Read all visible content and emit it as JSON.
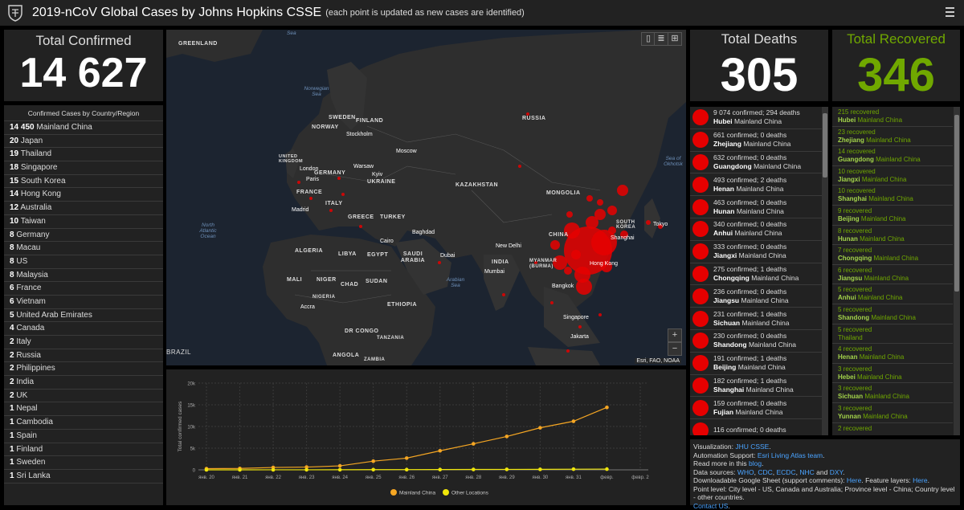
{
  "header": {
    "title": "2019-nCoV Global Cases by Johns Hopkins CSSE",
    "subtitle": "(each point is updated as new cases are identified)"
  },
  "total_confirmed": {
    "label": "Total Confirmed",
    "value": "14 627"
  },
  "country_list": {
    "heading": "Confirmed Cases by Country/Region",
    "items": [
      {
        "count": "14 450",
        "name": "Mainland China"
      },
      {
        "count": "20",
        "name": "Japan"
      },
      {
        "count": "19",
        "name": "Thailand"
      },
      {
        "count": "18",
        "name": "Singapore"
      },
      {
        "count": "15",
        "name": "South Korea"
      },
      {
        "count": "14",
        "name": "Hong Kong"
      },
      {
        "count": "12",
        "name": "Australia"
      },
      {
        "count": "10",
        "name": "Taiwan"
      },
      {
        "count": "8",
        "name": "Germany"
      },
      {
        "count": "8",
        "name": "Macau"
      },
      {
        "count": "8",
        "name": "US"
      },
      {
        "count": "8",
        "name": "Malaysia"
      },
      {
        "count": "6",
        "name": "France"
      },
      {
        "count": "6",
        "name": "Vietnam"
      },
      {
        "count": "5",
        "name": "United Arab Emirates"
      },
      {
        "count": "4",
        "name": "Canada"
      },
      {
        "count": "2",
        "name": "Italy"
      },
      {
        "count": "2",
        "name": "Russia"
      },
      {
        "count": "2",
        "name": "Philippines"
      },
      {
        "count": "2",
        "name": "India"
      },
      {
        "count": "2",
        "name": "UK"
      },
      {
        "count": "1",
        "name": "Nepal"
      },
      {
        "count": "1",
        "name": "Cambodia"
      },
      {
        "count": "1",
        "name": "Spain"
      },
      {
        "count": "1",
        "name": "Finland"
      },
      {
        "count": "1",
        "name": "Sweden"
      },
      {
        "count": "1",
        "name": "Sri Lanka"
      }
    ]
  },
  "map": {
    "attribution": "Esri, FAO, NOAA",
    "zoom_in": "+",
    "zoom_out": "−",
    "regions": [
      "GREENLAND",
      "NORWAY",
      "SWEDEN",
      "FINLAND",
      "RUSSIA",
      "UNITED KINGDOM",
      "GERMANY",
      "FRANCE",
      "UKRAINE",
      "KAZAKHSTAN",
      "MONGOLIA",
      "CHINA",
      "SOUTH KOREA",
      "ITALY",
      "GREECE",
      "TURKEY",
      "ALGERIA",
      "LIBYA",
      "EGYPT",
      "SAUDI ARABIA",
      "INDIA",
      "MYANMAR (BURMA)",
      "MALI",
      "NIGER",
      "CHAD",
      "SUDAN",
      "ETHIOPIA",
      "NIGERIA",
      "DR CONGO",
      "TANZANIA",
      "ANGOLA",
      "ZAMBIA",
      "BRAZIL"
    ],
    "cities": [
      "Stockholm",
      "Moscow",
      "London",
      "Paris",
      "Warsaw",
      "Kyiv",
      "Madrid",
      "Cairo",
      "Baghdad",
      "Dubai",
      "New Delhi",
      "Mumbai",
      "Bangkok",
      "Singapore",
      "Jakarta",
      "Tokyo",
      "Shanghai",
      "Hong Kong",
      "Accra"
    ],
    "seas": [
      "Sea",
      "Norwegian Sea",
      "North Atlantic Ocean",
      "Arabian Sea",
      "Sea of Okhotsk"
    ]
  },
  "chart_data": {
    "type": "line",
    "xlabel": "",
    "ylabel": "Total confirmed cases",
    "categories": [
      "янв. 20",
      "янв. 21",
      "янв. 22",
      "янв. 23",
      "янв. 24",
      "янв. 25",
      "янв. 26",
      "янв. 27",
      "янв. 28",
      "янв. 29",
      "янв. 30",
      "янв. 31",
      "февр.",
      "февр. 2"
    ],
    "yticks": [
      "0",
      "5k",
      "10k",
      "15k",
      "20k"
    ],
    "ylim": [
      0,
      20000
    ],
    "grid": true,
    "legend": "bottom",
    "series": [
      {
        "name": "Mainland China",
        "color": "#f5a623",
        "values": [
          278,
          326,
          547,
          639,
          916,
          2000,
          2700,
          4400,
          6000,
          7700,
          9700,
          11200,
          14400,
          null
        ]
      },
      {
        "name": "Other Locations",
        "color": "#f0e60a",
        "values": [
          4,
          6,
          8,
          14,
          25,
          40,
          57,
          64,
          87,
          105,
          118,
          153,
          173,
          null
        ]
      }
    ]
  },
  "total_deaths": {
    "label": "Total Deaths",
    "value": "305",
    "items": [
      {
        "stats": "9 074 confirmed; 294 deaths",
        "region": "Hubei",
        "country": "Mainland China"
      },
      {
        "stats": "661 confirmed; 0 deaths",
        "region": "Zhejiang",
        "country": "Mainland China"
      },
      {
        "stats": "632 confirmed; 0 deaths",
        "region": "Guangdong",
        "country": "Mainland China"
      },
      {
        "stats": "493 confirmed; 2 deaths",
        "region": "Henan",
        "country": "Mainland China"
      },
      {
        "stats": "463 confirmed; 0 deaths",
        "region": "Hunan",
        "country": "Mainland China"
      },
      {
        "stats": "340 confirmed; 0 deaths",
        "region": "Anhui",
        "country": "Mainland China"
      },
      {
        "stats": "333 confirmed; 0 deaths",
        "region": "Jiangxi",
        "country": "Mainland China"
      },
      {
        "stats": "275 confirmed; 1 deaths",
        "region": "Chongqing",
        "country": "Mainland China"
      },
      {
        "stats": "236 confirmed; 0 deaths",
        "region": "Jiangsu",
        "country": "Mainland China"
      },
      {
        "stats": "231 confirmed; 1 deaths",
        "region": "Sichuan",
        "country": "Mainland China"
      },
      {
        "stats": "230 confirmed; 0 deaths",
        "region": "Shandong",
        "country": "Mainland China"
      },
      {
        "stats": "191 confirmed; 1 deaths",
        "region": "Beijing",
        "country": "Mainland China"
      },
      {
        "stats": "182 confirmed; 1 deaths",
        "region": "Shanghai",
        "country": "Mainland China"
      },
      {
        "stats": "159 confirmed; 0 deaths",
        "region": "Fujian",
        "country": "Mainland China"
      },
      {
        "stats": "116 confirmed; 0 deaths",
        "region": "",
        "country": ""
      }
    ]
  },
  "total_recovered": {
    "label": "Total Recovered",
    "value": "346",
    "items": [
      {
        "count": "215 recovered",
        "region": "Hubei",
        "country": "Mainland China"
      },
      {
        "count": "23 recovered",
        "region": "Zhejiang",
        "country": "Mainland China"
      },
      {
        "count": "14 recovered",
        "region": "Guangdong",
        "country": "Mainland China"
      },
      {
        "count": "10 recovered",
        "region": "Jiangxi",
        "country": "Mainland China"
      },
      {
        "count": "10 recovered",
        "region": "Shanghai",
        "country": "Mainland China"
      },
      {
        "count": "9 recovered",
        "region": "Beijing",
        "country": "Mainland China"
      },
      {
        "count": "8 recovered",
        "region": "Hunan",
        "country": "Mainland China"
      },
      {
        "count": "7 recovered",
        "region": "Chongqing",
        "country": "Mainland China"
      },
      {
        "count": "6 recovered",
        "region": "Jiangsu",
        "country": "Mainland China"
      },
      {
        "count": "5 recovered",
        "region": "Anhui",
        "country": "Mainland China"
      },
      {
        "count": "5 recovered",
        "region": "Shandong",
        "country": "Mainland China"
      },
      {
        "count": "5 recovered",
        "region": "",
        "country": "Thailand"
      },
      {
        "count": "4 recovered",
        "region": "Henan",
        "country": "Mainland China"
      },
      {
        "count": "3 recovered",
        "region": "Hebei",
        "country": "Mainland China"
      },
      {
        "count": "3 recovered",
        "region": "Sichuan",
        "country": "Mainland China"
      },
      {
        "count": "3 recovered",
        "region": "Yunnan",
        "country": "Mainland China"
      },
      {
        "count": "2 recovered",
        "region": "",
        "country": ""
      }
    ]
  },
  "info": {
    "viz_label": "Visualization:",
    "viz_link": "JHU CSSE",
    "auto_label": "Automation Support:",
    "auto_link": "Esri Living Atlas team",
    "read_label": "Read more in this",
    "read_link": "blog",
    "src_label": "Data sources:",
    "src_links": [
      "WHO",
      "CDC",
      "ECDC",
      "NHC",
      "DXY"
    ],
    "src_and": "and",
    "sheet_label": "Downloadable Google Sheet (support comments):",
    "sheet_link": "Here",
    "layers_label": "Feature layers:",
    "layers_link": "Here",
    "point_level": "Point level: City level - US, Canada and Australia; Province level - China; Country level - other countries.",
    "contact_link": "Contact US"
  },
  "colors": {
    "confirmed": "#e60000",
    "recovered": "#70a800",
    "panel": "#222222",
    "link": "#4aa3ff"
  }
}
